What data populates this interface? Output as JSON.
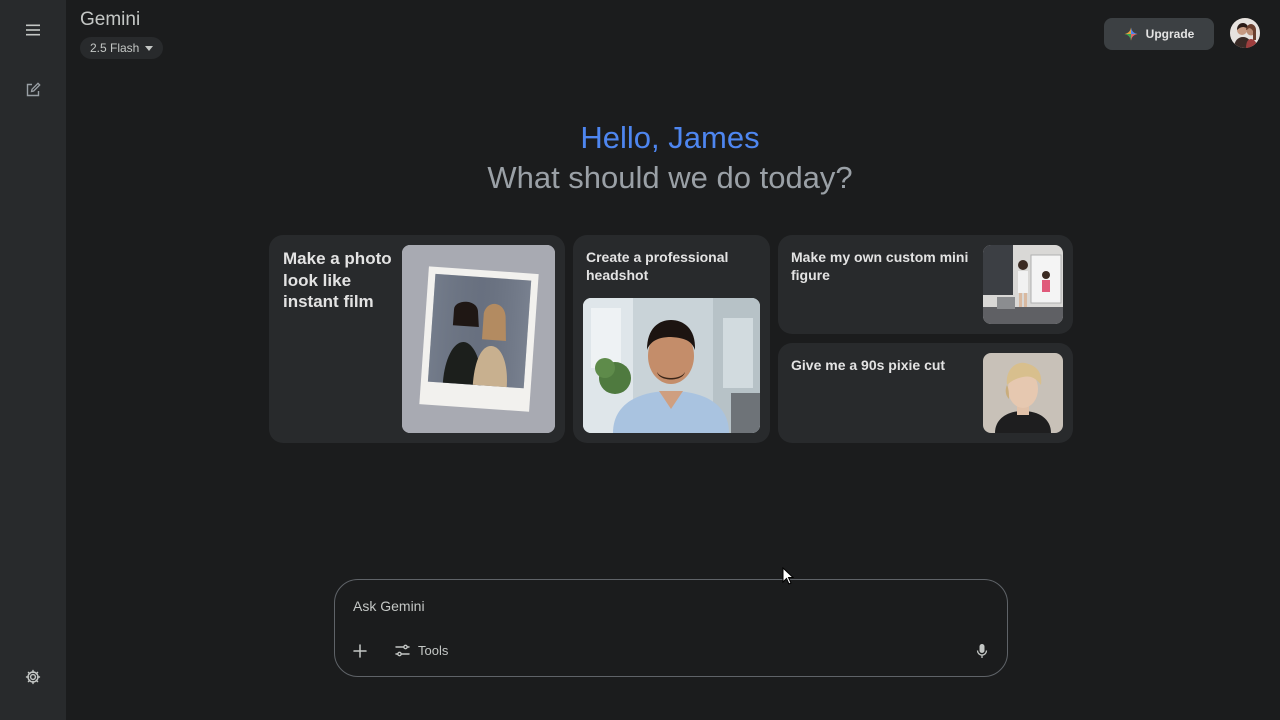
{
  "app": {
    "title": "Gemini",
    "model": "2.5 Flash"
  },
  "header": {
    "upgrade_label": "Upgrade"
  },
  "greeting": {
    "hello": "Hello, James",
    "prompt": "What should we do today?"
  },
  "cards": [
    {
      "title": "Make a photo look like instant film"
    },
    {
      "title": "Create a professional headshot"
    },
    {
      "title": "Make my own custom mini figure"
    },
    {
      "title": "Give me a 90s pixie cut"
    }
  ],
  "composer": {
    "placeholder": "Ask Gemini",
    "tools_label": "Tools"
  },
  "colors": {
    "accent": "#4e86f0",
    "background": "#1b1c1d",
    "sidebar": "#282a2c"
  },
  "icons": [
    "menu-icon",
    "new-chat-icon",
    "settings-icon",
    "sparkle-icon",
    "plus-icon",
    "tools-icon",
    "mic-icon"
  ]
}
